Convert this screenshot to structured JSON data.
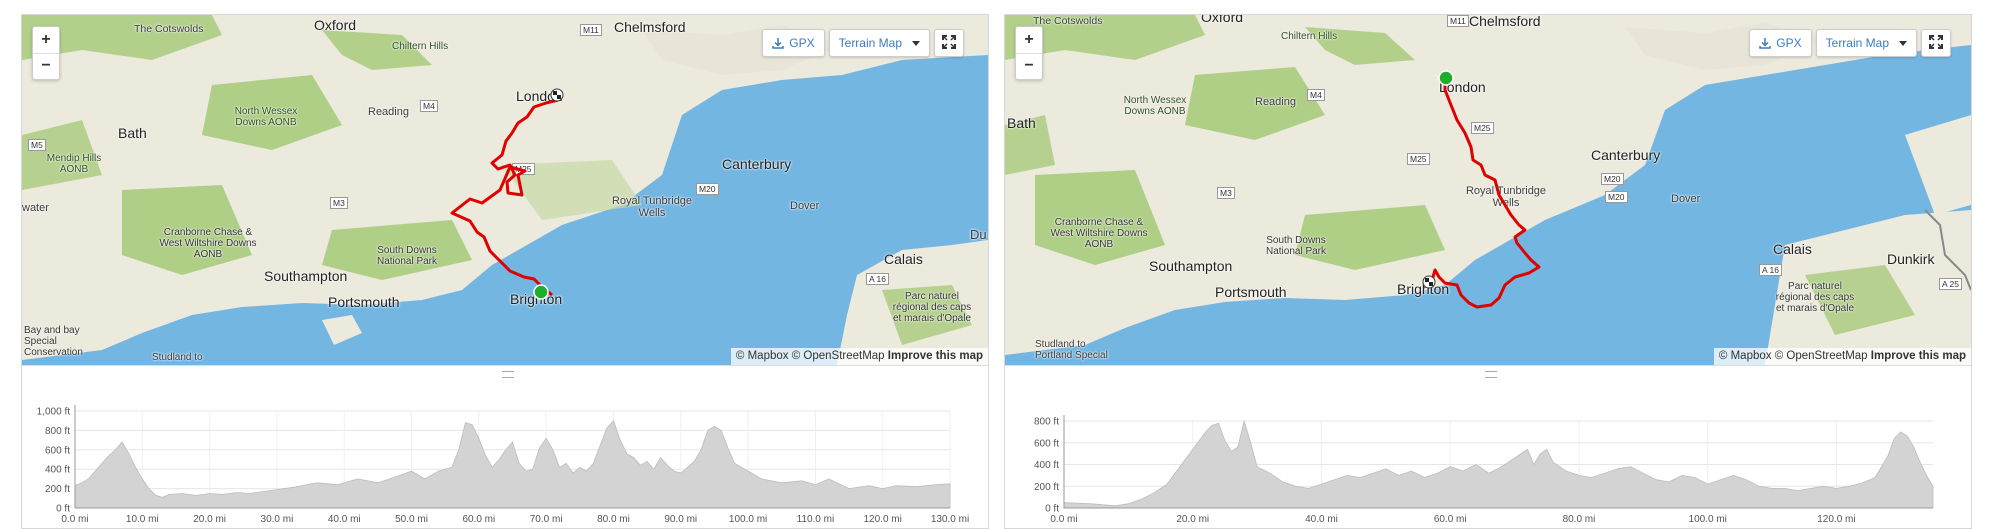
{
  "colors": {
    "water": "#73b6e2",
    "land": "#ece9dd",
    "green": "#a9cb7c",
    "route": "#e00000",
    "start": "#1fae2b",
    "elevation": "#d3d3d3"
  },
  "panels": [
    {
      "controls": {
        "zoom_in": "+",
        "zoom_out": "−",
        "gpx_label": "GPX",
        "map_type": "Terrain Map",
        "gpx_icon": "download-icon",
        "expand_icon": "expand-icon"
      },
      "attribution": {
        "mapbox": "© Mapbox",
        "osm": "© OpenStreetMap",
        "improve": "Improve this map"
      },
      "labels": {
        "cotswolds": "The Cotswolds",
        "oxford": "Oxford",
        "chelmsford": "Chelmsford",
        "chiltern": "Chiltern Hills",
        "m11": "M11",
        "bath": "Bath",
        "nwessex": "North Wessex Downs AONB",
        "reading": "Reading",
        "m4": "M4",
        "london": "London",
        "m5": "M5",
        "mendip": "Mendip Hills AONB",
        "m25": "M25",
        "canterbury": "Canterbury",
        "water": "water",
        "m3": "M3",
        "m20": "M20",
        "tunbridge": "Royal Tunbridge Wells",
        "dover": "Dover",
        "cranborne": "Cranborne Chase & West Wiltshire Downs AONB",
        "southdowns": "South Downs National Park",
        "southampton": "Southampton",
        "du": "Du",
        "calais": "Calais",
        "a16": "A 16",
        "portsmouth": "Portsmouth",
        "brighton": "Brighton",
        "opale": "Parc naturel régional des caps et marais d'Opale",
        "bay": "Bay and bay Special Conservation",
        "studland": "Studland to"
      },
      "chart_data": {
        "type": "area",
        "title": "",
        "xlabel": "",
        "ylabel": "",
        "xlim": [
          0,
          130
        ],
        "ylim": [
          0,
          1000
        ],
        "x_ticks": [
          "0.0 mi",
          "10.0 mi",
          "20.0 mi",
          "30.0 mi",
          "40.0 mi",
          "50.0 mi",
          "60.0 mi",
          "70.0 mi",
          "80.0 mi",
          "90.0 mi",
          "100.0 mi",
          "110.0 mi",
          "120.0 mi",
          "130.0 mi"
        ],
        "x_tick_values": [
          0,
          10,
          20,
          30,
          40,
          50,
          60,
          70,
          80,
          90,
          100,
          110,
          120,
          130
        ],
        "y_ticks": [
          "0 ft",
          "200 ft",
          "400 ft",
          "600 ft",
          "800 ft",
          "1,000 ft"
        ],
        "y_tick_values": [
          0,
          200,
          400,
          600,
          800,
          1000
        ],
        "x": [
          0,
          1,
          2,
          3,
          4,
          5,
          6,
          7,
          8,
          9,
          10,
          11,
          12,
          13,
          14,
          16,
          18,
          20,
          22,
          24,
          26,
          28,
          30,
          33,
          36,
          39,
          42,
          45,
          48,
          50,
          52,
          54,
          56,
          57,
          58,
          59,
          60,
          61,
          62,
          63,
          64,
          65,
          66,
          67,
          68,
          69,
          70,
          71,
          72,
          73,
          74,
          75,
          76,
          77,
          78,
          79,
          80,
          81,
          82,
          83,
          84,
          85,
          86,
          87,
          88,
          89,
          90,
          91,
          92,
          93,
          94,
          95,
          96,
          97,
          98,
          100,
          102,
          105,
          108,
          110,
          112,
          115,
          118,
          120,
          122,
          125,
          128,
          130
        ],
        "series": [
          {
            "values": [
              230,
              260,
              300,
              380,
              460,
              540,
              600,
              680,
              560,
              420,
              300,
              200,
              130,
              110,
              140,
              150,
              130,
              150,
              140,
              160,
              150,
              170,
              190,
              220,
              260,
              240,
              300,
              260,
              330,
              380,
              300,
              380,
              420,
              600,
              880,
              860,
              720,
              540,
              420,
              500,
              600,
              680,
              460,
              380,
              400,
              620,
              720,
              600,
              420,
              460,
              360,
              420,
              380,
              460,
              640,
              820,
              900,
              700,
              560,
              520,
              440,
              480,
              400,
              520,
              440,
              380,
              360,
              420,
              480,
              600,
              800,
              840,
              800,
              620,
              460,
              380,
              300,
              260,
              280,
              240,
              300,
              200,
              230,
              200,
              230,
              220,
              240,
              250
            ]
          }
        ]
      }
    },
    {
      "controls": {
        "zoom_in": "+",
        "zoom_out": "−",
        "gpx_label": "GPX",
        "map_type": "Terrain Map",
        "gpx_icon": "download-icon",
        "expand_icon": "expand-icon"
      },
      "attribution": {
        "mapbox": "© Mapbox",
        "osm": "© OpenStreetMap",
        "improve": "Improve this map"
      },
      "labels": {
        "cotswolds": "The Cotswolds",
        "oxford": "Oxford",
        "chelmsford": "Chelmsford",
        "chiltern": "Chiltern Hills",
        "m11": "M11",
        "bath": "Bath",
        "nwessex": "North Wessex Downs AONB",
        "reading": "Reading",
        "m4": "M4",
        "london": "London",
        "m25a": "M25",
        "m25b": "M25",
        "canterbury": "Canterbury",
        "m20a": "M20",
        "m20b": "M20",
        "m3": "M3",
        "tunbridge": "Royal Tunbridge Wells",
        "dover": "Dover",
        "cranborne": "Cranborne Chase & West Wiltshire Downs AONB",
        "southdowns": "South Downs National Park",
        "southampton": "Southampton",
        "dunkirk": "Dunkirk",
        "calais": "Calais",
        "a16": "A 16",
        "a25": "A 25",
        "portsmouth": "Portsmouth",
        "brighton": "Brighton",
        "opale": "Parc naturel régional des caps et marais d'Opale",
        "studland": "Studland to Portland Special"
      },
      "chart_data": {
        "type": "area",
        "title": "",
        "xlabel": "",
        "ylabel": "",
        "xlim": [
          0,
          135
        ],
        "ylim": [
          0,
          800
        ],
        "x_ticks": [
          "0.0 mi",
          "20.0 mi",
          "40.0 mi",
          "60.0 mi",
          "80.0 mi",
          "100.0 mi",
          "120.0 mi"
        ],
        "x_tick_values": [
          0,
          20,
          40,
          60,
          80,
          100,
          120
        ],
        "y_ticks": [
          "0 ft",
          "200 ft",
          "400 ft",
          "600 ft",
          "800 ft"
        ],
        "y_tick_values": [
          0,
          200,
          400,
          600,
          800
        ],
        "x": [
          0,
          2,
          4,
          6,
          8,
          10,
          12,
          14,
          16,
          17,
          18,
          19,
          20,
          21,
          22,
          23,
          24,
          25,
          26,
          27,
          28,
          29,
          30,
          32,
          34,
          36,
          38,
          40,
          42,
          44,
          46,
          48,
          50,
          52,
          54,
          56,
          58,
          60,
          62,
          64,
          66,
          68,
          70,
          72,
          73,
          74,
          75,
          76,
          78,
          80,
          82,
          84,
          86,
          88,
          90,
          92,
          94,
          96,
          98,
          100,
          102,
          104,
          106,
          108,
          110,
          112,
          114,
          116,
          118,
          120,
          122,
          124,
          126,
          128,
          129,
          130,
          131,
          132,
          133,
          134,
          135
        ],
        "series": [
          {
            "values": [
              50,
              45,
              40,
              30,
              20,
              40,
              80,
              140,
              220,
              300,
              380,
              460,
              540,
              620,
              700,
              760,
              780,
              620,
              520,
              560,
              800,
              600,
              380,
              320,
              240,
              200,
              180,
              220,
              260,
              300,
              280,
              320,
              360,
              300,
              340,
              280,
              320,
              380,
              340,
              400,
              320,
              380,
              460,
              540,
              400,
              500,
              540,
              420,
              340,
              300,
              280,
              320,
              360,
              380,
              320,
              260,
              240,
              300,
              280,
              220,
              260,
              300,
              260,
              200,
              180,
              180,
              160,
              180,
              200,
              180,
              200,
              230,
              280,
              480,
              640,
              700,
              660,
              560,
              420,
              300,
              200
            ]
          }
        ]
      }
    }
  ]
}
